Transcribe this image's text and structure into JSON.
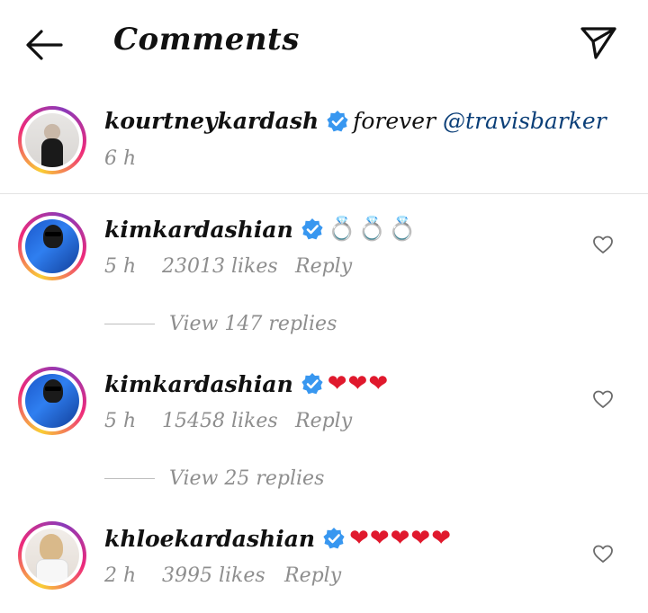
{
  "header": {
    "title": "Comments"
  },
  "caption": {
    "username": "kourtneykardash",
    "text": "forever",
    "mention": "@travisbarker",
    "time": "6 h"
  },
  "comments": [
    {
      "username": "kimkardashian",
      "text": "💍💍💍",
      "time": "5 h",
      "likes": "23013 likes",
      "reply": "Reply",
      "view_replies": "View 147 replies"
    },
    {
      "username": "kimkardashian",
      "text": "❤❤❤",
      "time": "5 h",
      "likes": "15458 likes",
      "reply": "Reply",
      "view_replies": "View 25 replies"
    },
    {
      "username": "khloekardashian",
      "text": "❤❤❤❤❤",
      "time": "2 h",
      "likes": "3995 likes",
      "reply": "Reply"
    }
  ],
  "colors": {
    "verified": "#3897f0",
    "mention": "#0b3f78",
    "heart_emoji": "#e0192d",
    "meta_text": "#8e8e8e"
  },
  "icons": {
    "back": "arrow-left-icon",
    "send": "paper-plane-icon",
    "like": "heart-outline-icon",
    "verified": "verified-badge-icon"
  }
}
